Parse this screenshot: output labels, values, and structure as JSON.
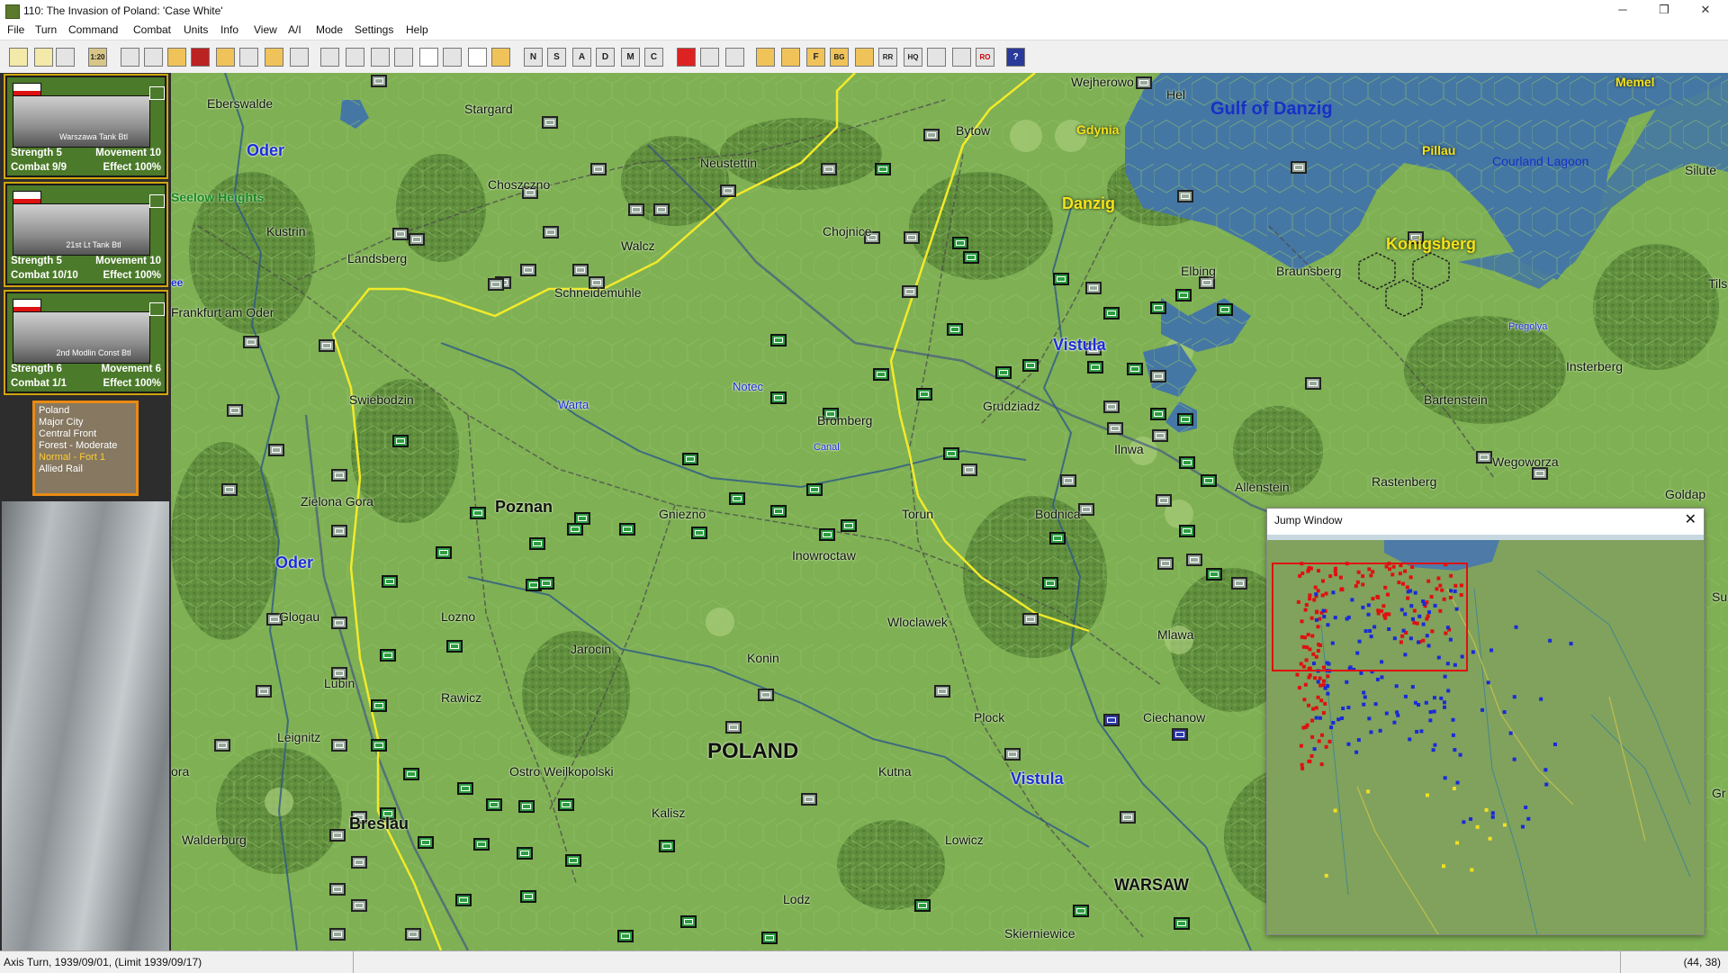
{
  "window": {
    "title": "110: The Invasion of Poland: 'Case White'",
    "controls": {
      "minimize": "─",
      "maximize": "❐",
      "close": "✕"
    }
  },
  "menu": [
    "File",
    "Turn",
    "Command",
    "Combat",
    "Units",
    "Info",
    "View",
    "A/I",
    "Mode",
    "Settings",
    "Help"
  ],
  "toolbar": {
    "zoom_label": "1:20",
    "letter_buttons": [
      "N",
      "S",
      "A",
      "D",
      "M",
      "C"
    ],
    "letter_buttons_2": [
      "F",
      "BG",
      "RR",
      "HQ",
      "RO"
    ],
    "help_label": "?"
  },
  "units_panel": {
    "cards": [
      {
        "name": "Warszawa Tank Btl",
        "strength": "Strength 5",
        "movement": "Movement 10",
        "combat": "Combat 9/9",
        "effect": "Effect 100%"
      },
      {
        "name": "21st Lt Tank Btl",
        "strength": "Strength 5",
        "movement": "Movement 10",
        "combat": "Combat 10/10",
        "effect": "Effect 100%"
      },
      {
        "name": "2nd Modlin Const Btl",
        "strength": "Strength 6",
        "movement": "Movement 6",
        "combat": "Combat 1/1",
        "effect": "Effect 100%"
      }
    ],
    "terrain": {
      "lines": [
        "Poland",
        "Major City",
        "Central Front",
        "Forest - Moderate"
      ],
      "highlight": "Normal - Fort 1",
      "last": "Allied Rail"
    }
  },
  "map": {
    "labels": {
      "eberswalde": "Eberswalde",
      "stargard": "Stargard",
      "wejherowo": "Wejherowo",
      "hel": "Hel",
      "gulf": "Gulf of Danzig",
      "memel": "Memel",
      "oder1": "Oder",
      "choszczno": "Choszczno",
      "neustettin": "Neustettin",
      "bytow": "Bytow",
      "gdynia": "Gdynia",
      "pillau": "Pillau",
      "courland": "Courland Lagoon",
      "silute": "Silute",
      "seelow": "Seelow Heights",
      "danzig": "Danzig",
      "kustrin": "Kustrin",
      "chojnice": "Chojnice",
      "landsberg": "Landsberg",
      "walcz": "Walcz",
      "konigsberg": "Konigsberg",
      "elbing": "Elbing",
      "braunsberg": "Braunsberg",
      "tilsit": "Tils",
      "schneidemuhle": "Schneidemuhle",
      "frankfurt": "Frankfurt am Oder",
      "pregolya": "Pregolya",
      "vistula1": "Vistula",
      "insterberg": "Insterberg",
      "notec": "Notec",
      "swiebodzin": "Swiebodzin",
      "warta": "Warta",
      "bromberg": "Bromberg",
      "grudziadz": "Grudziadz",
      "bartenstein": "Bartenstein",
      "canal": "Canal",
      "ilnwa": "Ilnwa",
      "wegoworza": "Wegoworza",
      "zielona": "Zielona Gora",
      "allenstein": "Allenstein",
      "rastenberg": "Rastenberg",
      "goldap": "Goldap",
      "poznan": "Poznan",
      "gniezno": "Gniezno",
      "torun": "Torun",
      "bodnica": "Bodnica",
      "oder2": "Oder",
      "inowroclaw": "Inowroctaw",
      "glogau": "Glogau",
      "lozno": "Lozno",
      "wloclawek": "Wloclawek",
      "mlawa": "Mlawa",
      "jarocin": "Jarocin",
      "konin": "Konin",
      "lubin": "Lubin",
      "rawicz": "Rawicz",
      "ciechanow": "Ciechanow",
      "plock": "Plock",
      "leignitz": "Leignitz",
      "poland": "POLAND",
      "ostro": "Ostro Weilkopolski",
      "kutna": "Kutna",
      "vistula2": "Vistula",
      "ora": "ora",
      "kalisz": "Kalisz",
      "breslau": "Breslau",
      "walderburg": "Walderburg",
      "lowicz": "Lowicz",
      "warsaw": "WARSAW",
      "lodz": "Lodz",
      "skierniewice": "Skierniewice",
      "ee": "ee",
      "su": "Su",
      "gr": "Gr"
    }
  },
  "jump_window": {
    "title": "Jump Window",
    "close": "✕"
  },
  "status": {
    "turn": "Axis Turn, 1939/09/01, (Limit 1939/09/17)",
    "coords": "(44, 38)"
  },
  "colors": {
    "map_green": "#7fb054",
    "forest": "#5d8a3a",
    "water": "#4577a4",
    "front_line": "#f2ea2a",
    "axis_units": "#9aa89b",
    "polish_units": "#2e9d42"
  }
}
